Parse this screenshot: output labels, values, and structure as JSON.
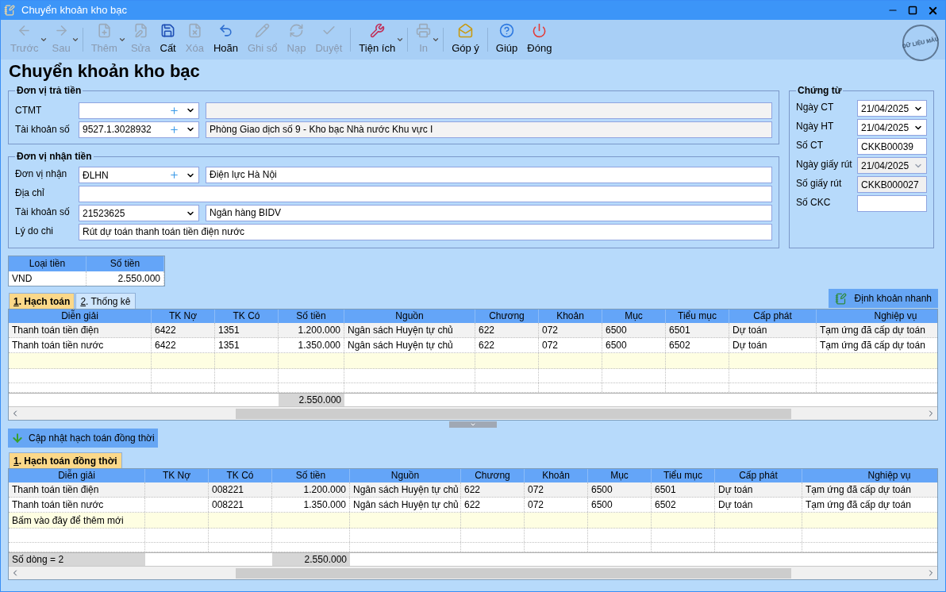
{
  "window": {
    "title": "Chuyển khoản kho bạc"
  },
  "toolbar": [
    {
      "label": "Trước",
      "kind": "back",
      "enabled": false,
      "dropdown": true
    },
    {
      "label": "Sau",
      "kind": "forward",
      "enabled": false,
      "dropdown": true
    },
    {
      "label": "Thêm",
      "kind": "new",
      "enabled": false,
      "dropdown": true
    },
    {
      "label": "Sửa",
      "kind": "edit",
      "enabled": false,
      "dropdown": false
    },
    {
      "label": "Cất",
      "kind": "save",
      "enabled": true,
      "dropdown": false
    },
    {
      "label": "Xóa",
      "kind": "delete",
      "enabled": false,
      "dropdown": false
    },
    {
      "label": "Hoãn",
      "kind": "undo",
      "enabled": true,
      "dropdown": false
    },
    {
      "label": "Ghi sổ",
      "kind": "pencil",
      "enabled": false,
      "dropdown": false
    },
    {
      "label": "Nạp",
      "kind": "reload",
      "enabled": false,
      "dropdown": false
    },
    {
      "label": "Duyệt",
      "kind": "check",
      "enabled": false,
      "dropdown": false
    },
    {
      "label": "Tiện ích",
      "kind": "tools",
      "enabled": true,
      "dropdown": true
    },
    {
      "label": "In",
      "kind": "print",
      "enabled": false,
      "dropdown": true
    },
    {
      "label": "Góp ý",
      "kind": "feedback",
      "enabled": true,
      "dropdown": false
    },
    {
      "label": "Giúp",
      "kind": "help",
      "enabled": true,
      "dropdown": false
    },
    {
      "label": "Đóng",
      "kind": "power",
      "enabled": true,
      "dropdown": false
    }
  ],
  "stamp": "DỮ LIỆU MẪU",
  "heading": "Chuyển khoản kho bạc",
  "payer": {
    "title": "Đơn vị trả tiền",
    "rows": [
      {
        "label": "CTMT",
        "add": true
      },
      {
        "label": "Tài khoản số",
        "value": "9527.1.3028932",
        "add": true,
        "name": "Phòng Giao dịch số 9 - Kho bạc Nhà nước Khu vực I"
      }
    ]
  },
  "payee": {
    "title": "Đơn vị nhận tiền",
    "rows": [
      {
        "kind": "combo",
        "label": "Đơn vị nhận",
        "value": "ĐLHN",
        "add": true,
        "name": "Điện lực Hà Nội"
      },
      {
        "kind": "text",
        "label": "Địa chỉ"
      },
      {
        "kind": "combo",
        "label": "Tài khoản số",
        "value": "21523625",
        "add": false,
        "name": "Ngân hàng BIDV"
      },
      {
        "kind": "text",
        "label": "Lý do chi",
        "value": "Rút dự toán thanh toán tiền điện nước"
      }
    ]
  },
  "voucher": {
    "title": "Chứng từ",
    "fields": [
      {
        "label": "Ngày CT",
        "value": "21/04/2025",
        "kind": "date",
        "disabled": false
      },
      {
        "label": "Ngày HT",
        "value": "21/04/2025",
        "kind": "date",
        "disabled": false
      },
      {
        "label": "Số CT",
        "value": "CKKB00039",
        "kind": "text",
        "disabled": false
      },
      {
        "label": "Ngày giấy rút",
        "value": "21/04/2025",
        "kind": "date",
        "disabled": true
      },
      {
        "label": "Số giấy rút",
        "value": "CKKB000027",
        "kind": "text",
        "disabled": true
      },
      {
        "label": "Số CKC",
        "kind": "text",
        "disabled": false
      }
    ]
  },
  "currency": {
    "columns": [
      "Loại tiền",
      "Số tiền"
    ],
    "row": [
      "VND",
      "2.550.000"
    ]
  },
  "tabs": [
    {
      "key": "1",
      "label": ". Hạch toán",
      "selected": true
    },
    {
      "key": "2",
      "label": ". Thống kê",
      "selected": false
    }
  ],
  "quick_button": "Định khoản nhanh",
  "grid": {
    "columns": [
      "Diễn giải",
      "TK Nợ",
      "TK Có",
      "Số tiền",
      "Nguồn",
      "Chương",
      "Khoản",
      "Mục",
      "Tiểu mục",
      "Cấp phát",
      "Nghiệp vụ"
    ],
    "rows": [
      {
        "selected": true,
        "cells": [
          "Thanh toán tiền điện",
          "6422",
          "1351",
          "1.200.000",
          "Ngân sách Huyện tự chủ",
          "622",
          "072",
          "6500",
          "6501",
          "Dự toán",
          "Tạm ứng đã cấp dự toán"
        ]
      },
      {
        "selected": false,
        "cells": [
          "Thanh toán tiền nước",
          "6422",
          "1351",
          "1.350.000",
          "Ngân sách Huyện tự chủ",
          "622",
          "072",
          "6500",
          "6502",
          "Dự toán",
          "Tạm ứng đã cấp dự toán"
        ]
      }
    ],
    "total": "2.550.000"
  },
  "update_button": "Cập nhật hạch toán đồng thời",
  "tabs2": [
    {
      "key": "1",
      "label": ". Hạch toán đồng thời",
      "selected": true
    }
  ],
  "grid2": {
    "columns": [
      "Diễn giải",
      "TK Nợ",
      "TK Có",
      "Số tiền",
      "Nguồn",
      "Chương",
      "Khoản",
      "Mục",
      "Tiểu mục",
      "Cấp phát",
      "Nghiệp vụ"
    ],
    "rows": [
      {
        "selected": true,
        "cells": [
          "Thanh toán tiền điện",
          "",
          "008221",
          "1.200.000",
          "Ngân sách Huyện tự chủ",
          "622",
          "072",
          "6500",
          "6501",
          "Dự toán",
          "Tạm ứng đã cấp dự toán"
        ]
      },
      {
        "selected": false,
        "cells": [
          "Thanh toán tiền nước",
          "",
          "008221",
          "1.350.000",
          "Ngân sách Huyện tự chủ",
          "622",
          "072",
          "6500",
          "6502",
          "Dự toán",
          "Tạm ứng đã cấp dự toán"
        ]
      }
    ],
    "new_row": "Bấm vào đây để thêm mới",
    "count": "Số dòng = 2",
    "total": "2.550.000"
  }
}
